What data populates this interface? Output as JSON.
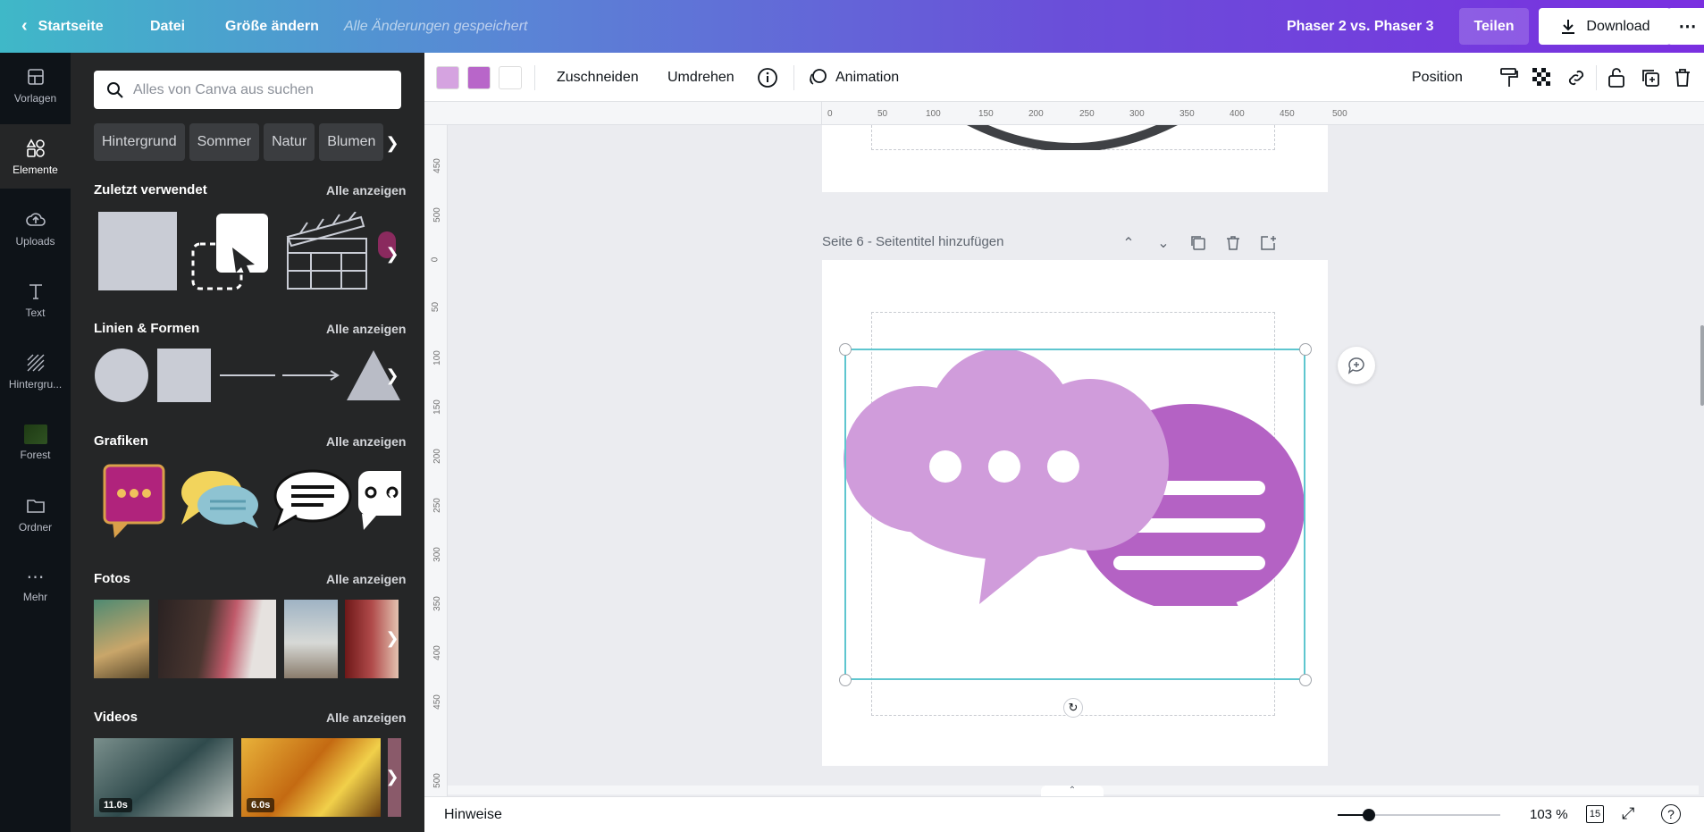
{
  "topbar": {
    "home": "Startseite",
    "file": "Datei",
    "resize": "Größe ändern",
    "saved_status": "Alle Änderungen gespeichert",
    "doc_title": "Phaser 2 vs. Phaser 3",
    "share": "Teilen",
    "download": "Download"
  },
  "rail": {
    "items": [
      {
        "label": "Vorlagen",
        "icon": "templates-icon"
      },
      {
        "label": "Elemente",
        "icon": "elements-icon"
      },
      {
        "label": "Uploads",
        "icon": "upload-cloud-icon"
      },
      {
        "label": "Text",
        "icon": "text-icon"
      },
      {
        "label": "Hintergru...",
        "icon": "background-icon"
      },
      {
        "label": "Forest",
        "icon": "forest-thumbnail-icon"
      },
      {
        "label": "Ordner",
        "icon": "folder-icon"
      },
      {
        "label": "Mehr",
        "icon": "more-dots-icon"
      }
    ]
  },
  "panel": {
    "search_placeholder": "Alles von Canva aus suchen",
    "chips": [
      "Hintergrund",
      "Sommer",
      "Natur",
      "Blumen"
    ],
    "see_all": "Alle anzeigen",
    "sections": {
      "recent": "Zuletzt verwendet",
      "shapes": "Linien & Formen",
      "graphics": "Grafiken",
      "photos": "Fotos",
      "videos": "Videos"
    },
    "videos": [
      {
        "duration": "11.0s"
      },
      {
        "duration": "6.0s"
      }
    ]
  },
  "toolbar": {
    "colors": [
      "#d5a3e0",
      "#b866c9",
      "#ffffff"
    ],
    "crop": "Zuschneiden",
    "flip": "Umdrehen",
    "animation": "Animation",
    "position": "Position"
  },
  "ruler": {
    "h_ticks": [
      "0",
      "50",
      "100",
      "150",
      "200",
      "250",
      "300",
      "350",
      "400",
      "450",
      "500"
    ],
    "v_ticks": [
      "450",
      "500",
      "0",
      "50",
      "100",
      "150",
      "200",
      "250",
      "300",
      "350",
      "400",
      "450",
      "500"
    ]
  },
  "page": {
    "header_number": "Seite 6",
    "header_sep": " - ",
    "header_title_placeholder": "Seitentitel hinzufügen"
  },
  "colors": {
    "bubble_light": "#d09cdb",
    "bubble_dark": "#b462c4",
    "selection": "#5ec6cf",
    "panel_bg": "#252627",
    "rail_bg": "#0e1318"
  },
  "statusbar": {
    "notes": "Hinweise",
    "zoom": "103 %",
    "page_count": "15"
  }
}
